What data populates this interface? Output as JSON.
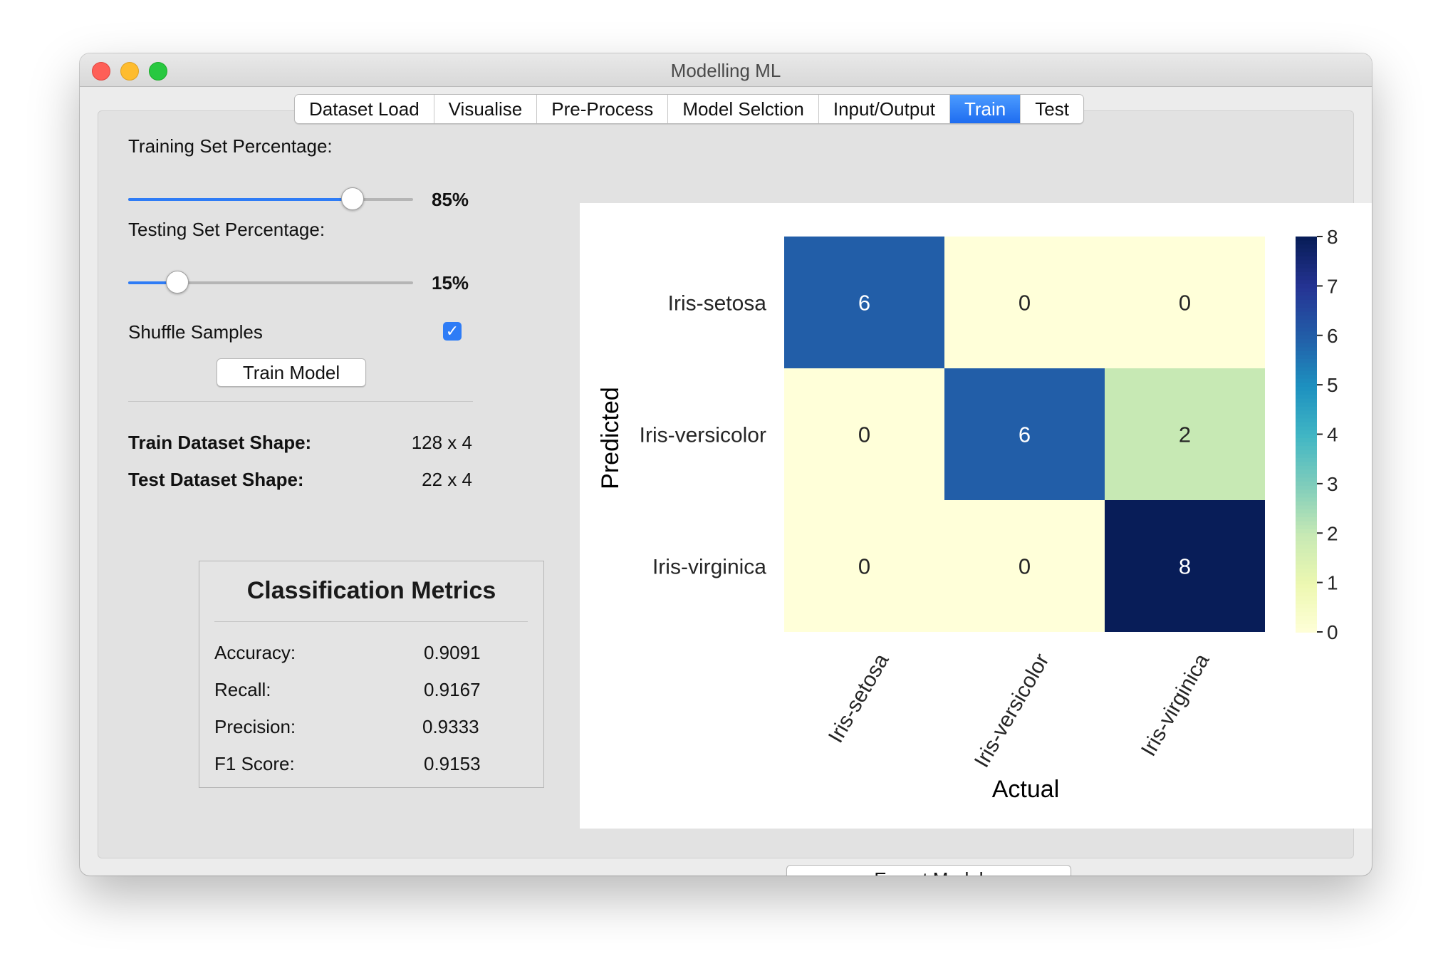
{
  "window": {
    "title": "Modelling ML"
  },
  "tabs": [
    {
      "label": "Dataset Load",
      "active": false
    },
    {
      "label": "Visualise",
      "active": false
    },
    {
      "label": "Pre-Process",
      "active": false
    },
    {
      "label": "Model Selction",
      "active": false
    },
    {
      "label": "Input/Output",
      "active": false
    },
    {
      "label": "Train",
      "active": true
    },
    {
      "label": "Test",
      "active": false
    }
  ],
  "training": {
    "label": "Training Set Percentage:",
    "value_text": "85%",
    "fraction": 0.85
  },
  "testing": {
    "label": "Testing Set Percentage:",
    "value_text": "15%",
    "fraction": 0.15
  },
  "shuffle": {
    "label": "Shuffle Samples",
    "checked": true,
    "check_glyph": "✓"
  },
  "train_button": {
    "label": "Train  Model"
  },
  "shapes": {
    "train_label": "Train Dataset Shape:",
    "train_value": "128 x 4",
    "test_label": "Test Dataset Shape:",
    "test_value": "22 x 4"
  },
  "metrics": {
    "title": "Classification Metrics",
    "rows": [
      {
        "label": "Accuracy:",
        "value": "0.9091"
      },
      {
        "label": "Recall:",
        "value": "0.9167"
      },
      {
        "label": "Precision:",
        "value": "0.9333"
      },
      {
        "label": "F1 Score:",
        "value": "0.9153"
      }
    ]
  },
  "export_button": {
    "label": "Export Model"
  },
  "colors": {
    "accent": "#2e7cf6",
    "colormap": "YlGnBu"
  },
  "chart_data": {
    "type": "heatmap",
    "title": "",
    "xlabel": "Actual",
    "ylabel": "Predicted",
    "x_categories": [
      "Iris-setosa",
      "Iris-versicolor",
      "Iris-virginica"
    ],
    "y_categories": [
      "Iris-setosa",
      "Iris-versicolor",
      "Iris-virginica"
    ],
    "values": [
      [
        6,
        0,
        0
      ],
      [
        0,
        6,
        2
      ],
      [
        0,
        0,
        8
      ]
    ],
    "colorbar": {
      "min": 0,
      "max": 8,
      "ticks": [
        "0",
        "1",
        "2",
        "3",
        "4",
        "5",
        "6",
        "7",
        "8"
      ]
    },
    "grid": false,
    "legend": "colorbar-right"
  }
}
